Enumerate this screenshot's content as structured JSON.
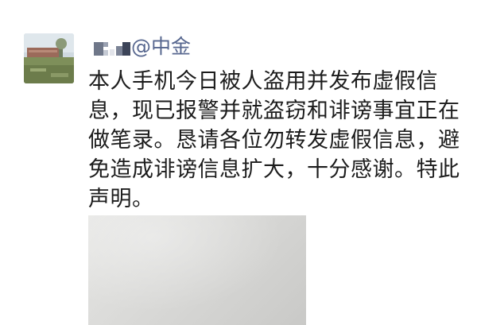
{
  "post": {
    "author_handle": "@中金",
    "text": "本人手机今日被人盗用并发布虚假信息，现已报警并就盗窃和诽谤事宜正在做笔录。恳请各位勿转发虚假信息，避免造成诽谤信息扩大，十分感谢。特此声明。"
  },
  "colors": {
    "author_name": "#57678f",
    "body_text": "#1c1c1c",
    "background": "#ffffff",
    "photo_gray": "#d6d6d4"
  }
}
